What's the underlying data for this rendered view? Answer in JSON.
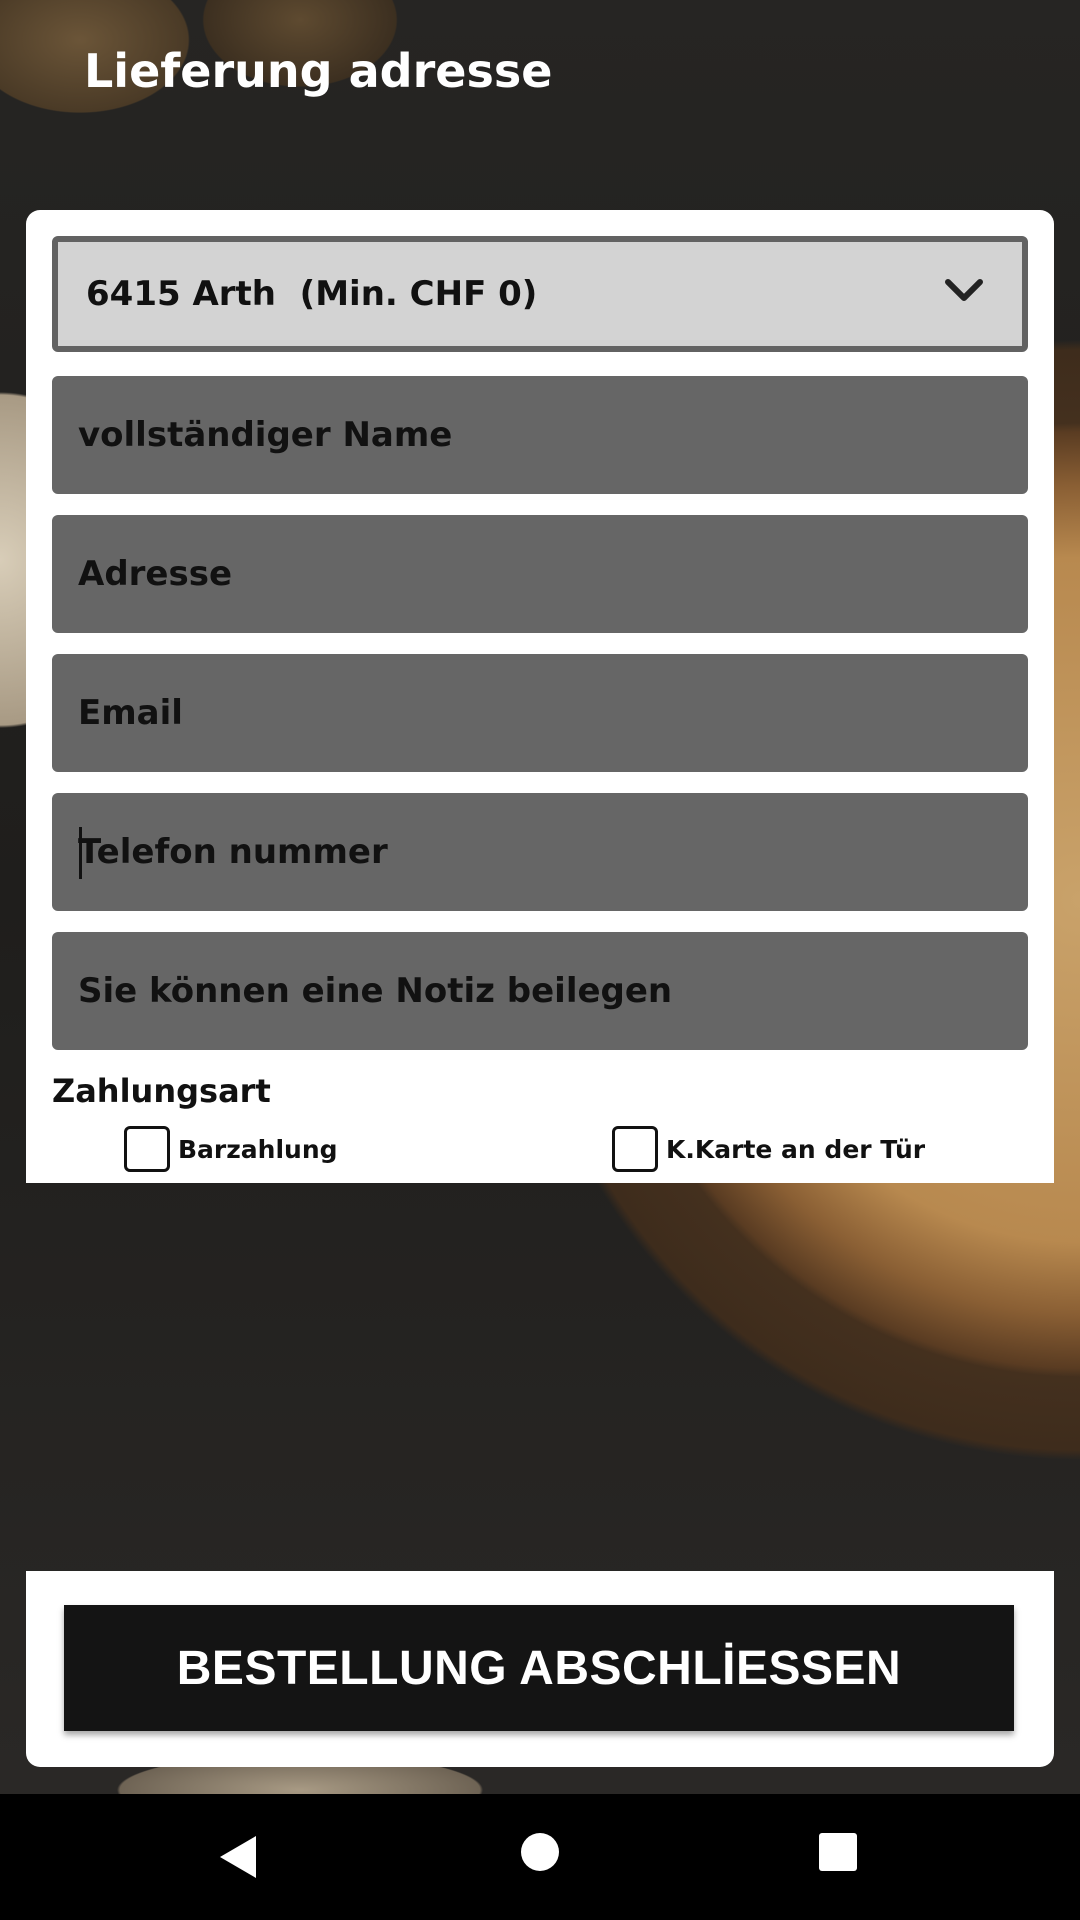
{
  "header": {
    "title": "Lieferung adresse"
  },
  "form": {
    "location_select": {
      "value": "6415 Arth  (Min. CHF 0)"
    },
    "fields": {
      "name_placeholder": "vollständiger Name",
      "address_placeholder": "Adresse",
      "email_placeholder": "Email",
      "phone_placeholder": "Telefon nummer",
      "note_placeholder": "Sie können eine Notiz beilegen"
    },
    "payment": {
      "label": "Zahlungsart",
      "options": [
        {
          "label": "Barzahlung",
          "checked": false
        },
        {
          "label": "K.Karte an der Tür",
          "checked": false
        }
      ]
    }
  },
  "footer": {
    "submit_label": "BESTELLUNG ABSCHLİESSEN"
  },
  "navbar": {
    "icons": [
      "back-icon",
      "home-icon",
      "recents-icon"
    ]
  },
  "colors": {
    "field_bg": "#666666",
    "select_bg": "#d3d3d3",
    "button_bg": "#141414",
    "card_bg": "#ffffff"
  }
}
